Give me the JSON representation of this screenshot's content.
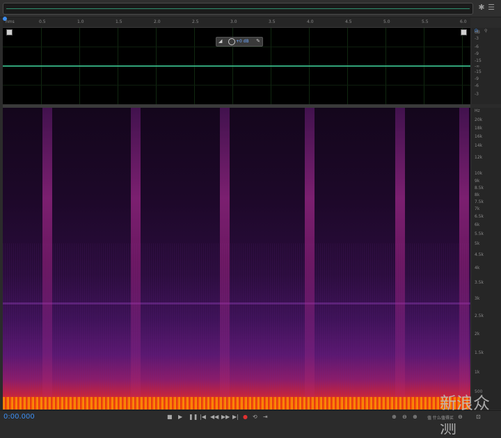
{
  "ruler": {
    "unit": "hms",
    "ticks": [
      "0.5",
      "1.0",
      "1.5",
      "2.0",
      "2.5",
      "3.0",
      "3.5",
      "4.0",
      "4.5",
      "5.0",
      "5.5",
      "6.0"
    ]
  },
  "hud": {
    "gain": "+0 dB"
  },
  "db_scale": {
    "unit": "dB",
    "labels": [
      "-3",
      "-6",
      "-9",
      "-15",
      "-∞",
      "-15",
      "-9",
      "-6",
      "-3"
    ]
  },
  "hz_scale": {
    "unit": "Hz",
    "labels": [
      "20k",
      "18k",
      "16k",
      "14k",
      "12k",
      "10k",
      "9k",
      "8.5k",
      "8k",
      "7.5k",
      "7k",
      "6.5k",
      "6k",
      "5.5k",
      "5k",
      "4.5k",
      "4k",
      "3.5k",
      "3k",
      "2.5k",
      "2k",
      "1.5k",
      "1k",
      "500"
    ]
  },
  "transport": {
    "timecode": "0:00.000",
    "buttons": [
      "stop",
      "play",
      "pause",
      "skip-back",
      "rewind",
      "fast-forward",
      "skip-forward",
      "record",
      "loop",
      "skip-selection"
    ]
  },
  "zoom_buttons": [
    "zoom-in-amplitude",
    "zoom-out-amplitude",
    "zoom-in-time",
    "zoom-out-time",
    "zoom-full"
  ],
  "watermark": {
    "text": "新浪众测",
    "sub": "值 什么值得买"
  },
  "colors": {
    "accent": "#3d8ef0",
    "waveform": "#3bbf8e",
    "record": "#e03131"
  }
}
